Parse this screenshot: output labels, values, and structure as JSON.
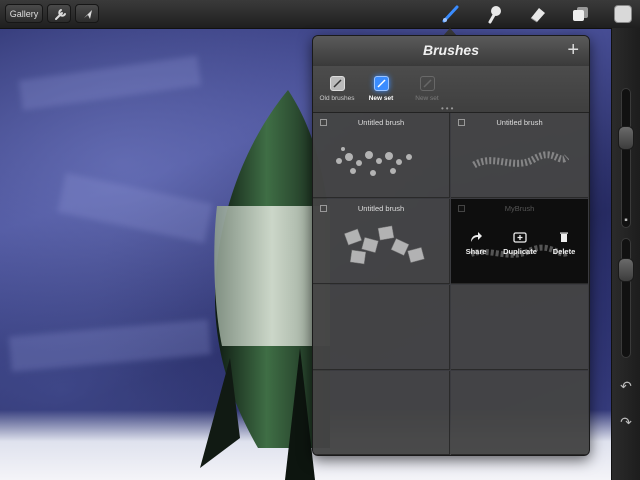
{
  "toolbar": {
    "gallery_label": "Gallery",
    "icons": [
      "wrench-icon",
      "cursor-icon",
      "brush-icon",
      "smudge-icon",
      "eraser-icon",
      "layers-icon",
      "color-swatch"
    ]
  },
  "brushes": {
    "title": "Brushes",
    "sets": [
      {
        "label": "Old brushes",
        "state": "normal"
      },
      {
        "label": "New set",
        "state": "selected"
      },
      {
        "label": "New set",
        "state": "disabled"
      }
    ],
    "items": [
      {
        "name": "Untitled brush"
      },
      {
        "name": "Untitled brush"
      },
      {
        "name": "Untitled brush"
      },
      {
        "name": "MyBrush"
      }
    ],
    "actions": [
      {
        "label": "Share",
        "icon": "share-icon"
      },
      {
        "label": "Duplicate",
        "icon": "duplicate-icon"
      },
      {
        "label": "Delete",
        "icon": "trash-icon"
      }
    ]
  },
  "colors": {
    "accent": "#3a8cff",
    "popover": "#3c3c3c",
    "selected_cell": "#0e0e0e"
  }
}
